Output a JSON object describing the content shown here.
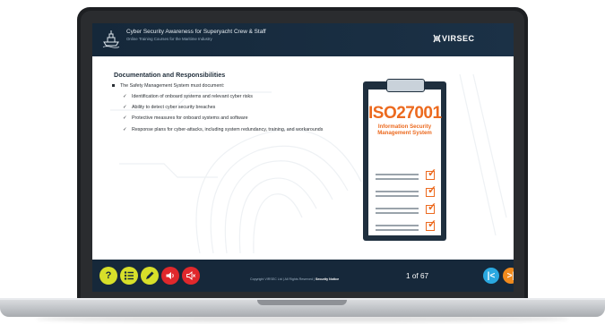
{
  "header": {
    "course_title": "Cyber Security Awareness for Superyacht Crew & Staff",
    "course_subtitle": "Online Training Courses for the Maritime Industry",
    "brand": "VIRSEC"
  },
  "slide": {
    "title": "Documentation and Responsibilities",
    "intro": "The Safety Management System must document:",
    "items": [
      "Identification of onboard systems and relevant cyber risks",
      "Ability to detect cyber security breaches",
      "Protective measures for onboard systems and software",
      "Response plans for cyber-attacks, including system redundancy, training, and workarounds"
    ],
    "graphic": {
      "heading": "ISO27001",
      "subheading": "Information Security Management System"
    }
  },
  "footer": {
    "tools": [
      {
        "icon": "help-icon",
        "color": "#d7df2a"
      },
      {
        "icon": "menu-list-icon",
        "color": "#d7df2a"
      },
      {
        "icon": "notes-pencil-icon",
        "color": "#d7df2a"
      },
      {
        "icon": "audio-on-icon",
        "color": "#e0282c"
      },
      {
        "icon": "audio-off-icon",
        "color": "#e0282c"
      }
    ],
    "copyright": "Copyright VIRSEC Ltd  |  All Rights Reserved  |",
    "security_notice": "Security Notice",
    "page_current": "1",
    "page_of": "of",
    "page_total": "67",
    "prev_color": "#2aa8e0",
    "next_color": "#f08a1d"
  },
  "colors": {
    "accent_orange": "#ec6a1f",
    "bar_navy": "#16283a"
  }
}
